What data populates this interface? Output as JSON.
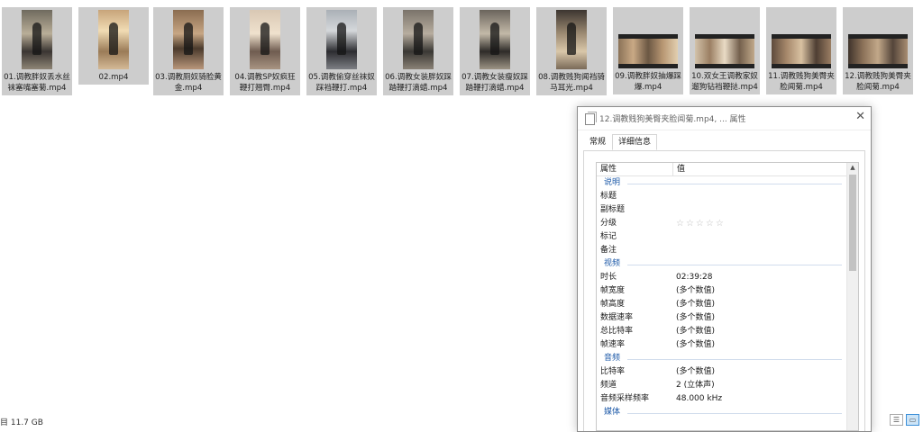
{
  "files": [
    {
      "name": "01.调教胖奴丢水丝袜塞嘴塞菊.mp4",
      "kind": "portrait",
      "scene": "s1"
    },
    {
      "name": "02.mp4",
      "kind": "portrait",
      "scene": "s2"
    },
    {
      "name": "03.调教厕奴骑脸黄金.mp4",
      "kind": "portrait",
      "scene": "s3"
    },
    {
      "name": "04.调教SP奴疯狂鞭打翘臀.mp4",
      "kind": "portrait",
      "scene": "s4"
    },
    {
      "name": "05.调教偷穿丝袜奴踩裆鞭打.mp4",
      "kind": "portrait",
      "scene": "s5"
    },
    {
      "name": "06.调教女装胖奴踩踏鞭打滴蜡.mp4",
      "kind": "portrait",
      "scene": "s6"
    },
    {
      "name": "07.调教女装瘦奴踩踏鞭打滴蜡.mp4",
      "kind": "portrait",
      "scene": "s7"
    },
    {
      "name": "08.调教贱狗闻裆骑马耳光.mp4",
      "kind": "portrait",
      "scene": "s8"
    },
    {
      "name": "09.调教胖奴抽爆踩爆.mp4",
      "kind": "landscape",
      "scene": "l9"
    },
    {
      "name": "10.双女王调教家奴遛狗钻裆鞭挞.mp4",
      "kind": "landscape",
      "scene": "l10"
    },
    {
      "name": "11.调教贱狗美臀夹脸闻菊.mp4",
      "kind": "landscape",
      "scene": "l11"
    },
    {
      "name": "12.调教贱狗美臀夹脸闻菊.mp4",
      "kind": "landscape",
      "scene": "l12"
    }
  ],
  "status": {
    "text": "目  11.7 GB"
  },
  "dialog": {
    "title": "12.调教贱狗美臀夹脸闻菊.mp4, ... 属性",
    "close": "✕",
    "tabs": [
      "常规",
      "详细信息"
    ],
    "header": {
      "prop": "属性",
      "val": "值"
    },
    "sections": [
      {
        "group": "说明",
        "rows": [
          {
            "k": "标题",
            "v": ""
          },
          {
            "k": "副标题",
            "v": ""
          },
          {
            "k": "分级",
            "v": "☆☆☆☆☆",
            "stars": true
          },
          {
            "k": "标记",
            "v": ""
          },
          {
            "k": "备注",
            "v": ""
          }
        ]
      },
      {
        "group": "视频",
        "rows": [
          {
            "k": "时长",
            "v": "02:39:28"
          },
          {
            "k": "帧宽度",
            "v": "(多个数值)"
          },
          {
            "k": "帧高度",
            "v": "(多个数值)"
          },
          {
            "k": "数据速率",
            "v": "(多个数值)"
          },
          {
            "k": "总比特率",
            "v": "(多个数值)"
          },
          {
            "k": "帧速率",
            "v": "(多个数值)"
          }
        ]
      },
      {
        "group": "音频",
        "rows": [
          {
            "k": "比特率",
            "v": "(多个数值)"
          },
          {
            "k": "频道",
            "v": "2 (立体声)"
          },
          {
            "k": "音频采样频率",
            "v": "48.000 kHz"
          }
        ]
      },
      {
        "group": "媒体",
        "rows": []
      }
    ]
  }
}
